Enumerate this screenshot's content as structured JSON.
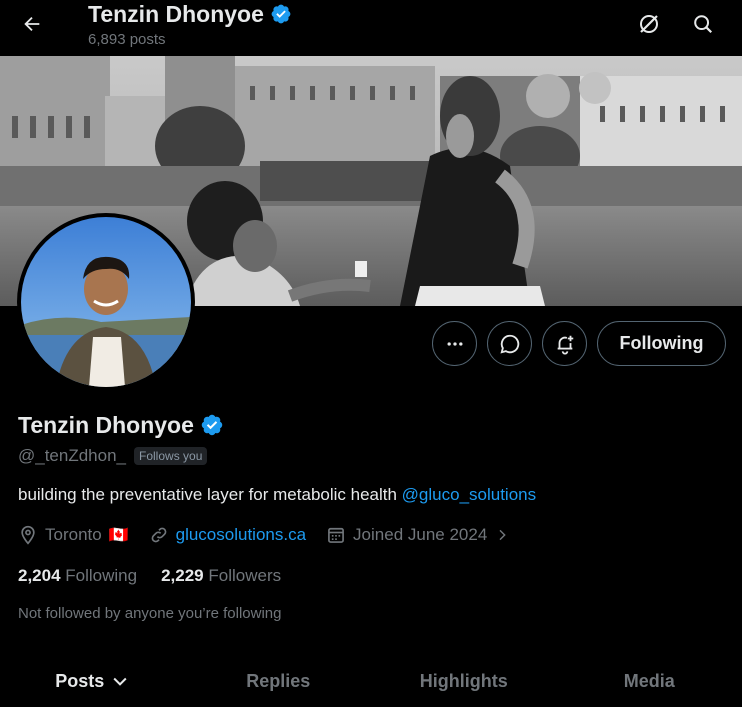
{
  "header": {
    "title": "Tenzin Dhonyoe",
    "posts_count": "6,893 posts",
    "icons": [
      "back-arrow-icon",
      "grok-icon",
      "search-icon"
    ]
  },
  "profile": {
    "name": "Tenzin Dhonyoe",
    "handle": "@_tenZdhon_",
    "follows_you": "Follows you",
    "bio_text": "building the preventative layer for metabolic health ",
    "bio_mention": "@gluco_solutions",
    "location": "Toronto",
    "location_flag": "🇨🇦",
    "website": "glucosolutions.ca",
    "joined": "Joined June 2024",
    "following_count": "2,204",
    "following_label": "Following",
    "followers_count": "2,229",
    "followers_label": "Followers",
    "not_followed": "Not followed by anyone you’re following"
  },
  "actions": {
    "following_button": "Following",
    "icons": [
      "more-icon",
      "message-icon",
      "notification-bell-icon"
    ]
  },
  "tabs": [
    {
      "label": "Posts",
      "active": true
    },
    {
      "label": "Replies",
      "active": false
    },
    {
      "label": "Highlights",
      "active": false
    },
    {
      "label": "Media",
      "active": false
    }
  ],
  "colors": {
    "background": "#000000",
    "text_primary": "#e7e9ea",
    "text_secondary": "#71767b",
    "link": "#1d9bf0",
    "verified": "#1d9bf0",
    "border": "#536471"
  }
}
